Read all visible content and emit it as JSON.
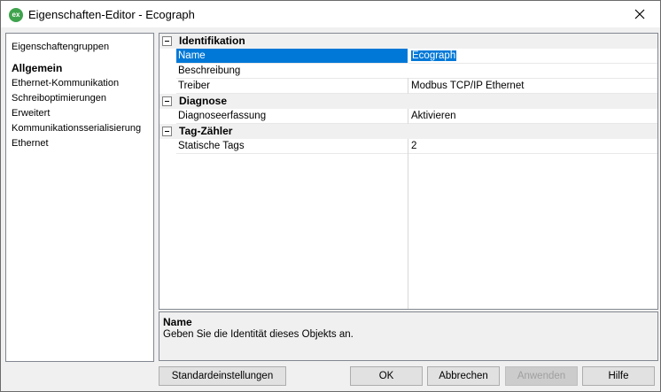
{
  "window": {
    "icon_text": "ex",
    "title": "Eigenschaften-Editor - Ecograph"
  },
  "groups": {
    "header": "Eigenschaftengruppen",
    "items": [
      {
        "label": "Allgemein",
        "active": true
      },
      {
        "label": "Ethernet-Kommunikation"
      },
      {
        "label": "Schreiboptimierungen"
      },
      {
        "label": "Erweitert"
      },
      {
        "label": "Kommunikationsserialisierung"
      },
      {
        "label": "Ethernet"
      }
    ]
  },
  "grid": {
    "categories": [
      {
        "label": "Identifikation",
        "properties": [
          {
            "name": "Name",
            "value": "Ecograph",
            "selected": true
          },
          {
            "name": "Beschreibung",
            "value": ""
          },
          {
            "name": "Treiber",
            "value": "Modbus TCP/IP Ethernet"
          }
        ]
      },
      {
        "label": "Diagnose",
        "properties": [
          {
            "name": "Diagnoseerfassung",
            "value": "Aktivieren"
          }
        ]
      },
      {
        "label": "Tag-Zähler",
        "properties": [
          {
            "name": "Statische Tags",
            "value": "2"
          }
        ]
      }
    ]
  },
  "help": {
    "title": "Name",
    "text": "Geben Sie die Identität dieses Objekts an."
  },
  "buttons": {
    "defaults": "Standardeinstellungen",
    "ok": "OK",
    "cancel": "Abbrechen",
    "apply": "Anwenden",
    "help": "Hilfe"
  }
}
